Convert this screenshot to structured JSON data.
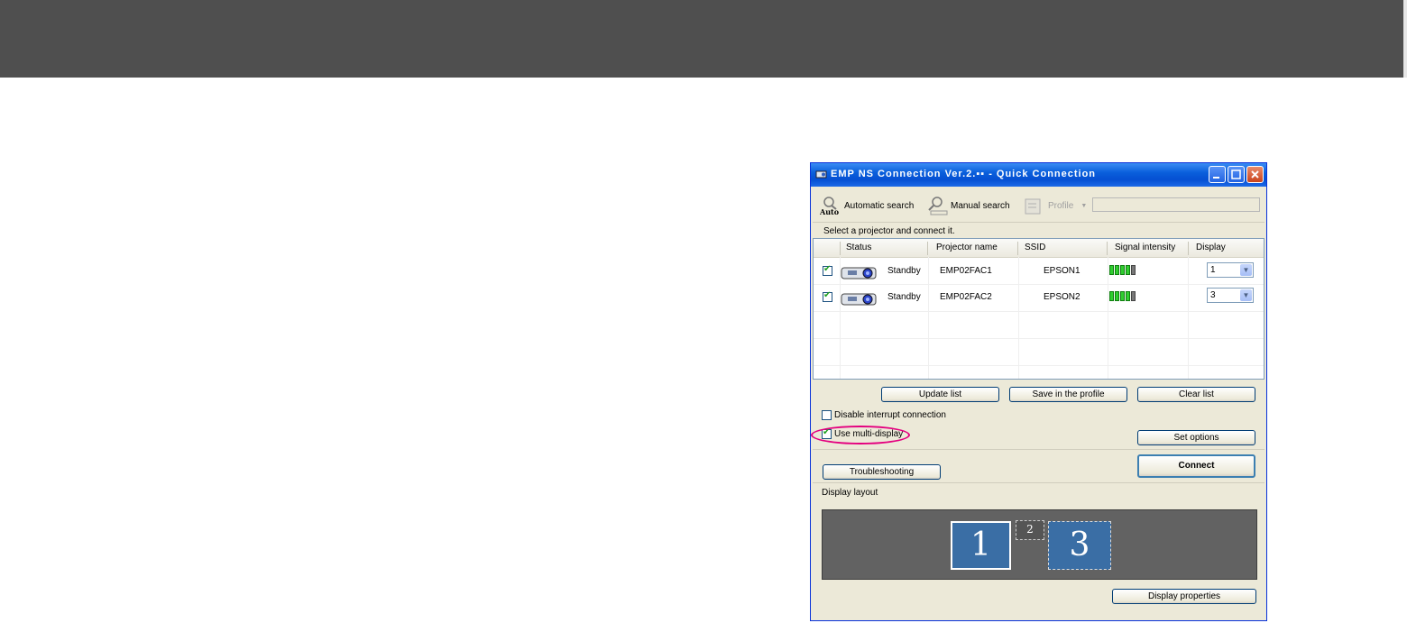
{
  "window": {
    "title": "EMP NS Connection Ver.2.▪▪ - Quick Connection"
  },
  "toolbar": {
    "automatic_search": "Automatic search",
    "auto_icon_label": "Auto",
    "manual_search": "Manual search",
    "profile": "Profile"
  },
  "hint": "Select a projector and connect it.",
  "table": {
    "columns": [
      "Status",
      "Projector name",
      "SSID",
      "Signal intensity",
      "Display"
    ],
    "rows": [
      {
        "checked": true,
        "status": "Standby",
        "name": "EMP02FAC1",
        "ssid": "EPSON1",
        "signal": 4,
        "display": "1"
      },
      {
        "checked": true,
        "status": "Standby",
        "name": "EMP02FAC2",
        "ssid": "EPSON2",
        "signal": 4,
        "display": "3"
      }
    ]
  },
  "buttons": {
    "update_list": "Update list",
    "save_profile": "Save in the profile",
    "clear_list": "Clear list",
    "set_options": "Set options",
    "troubleshooting": "Troubleshooting",
    "connect": "Connect",
    "display_properties": "Display properties"
  },
  "options": {
    "disable_interrupt": "Disable interrupt connection",
    "disable_interrupt_checked": false,
    "multi_display": "Use multi-display",
    "multi_display_checked": true
  },
  "display_layout": {
    "label": "Display layout",
    "screens": [
      "1",
      "2",
      "3"
    ]
  },
  "colors": {
    "banner": "#4f4f4f",
    "highlight": "#e4007f",
    "titlebar": "#0a5fdc"
  }
}
